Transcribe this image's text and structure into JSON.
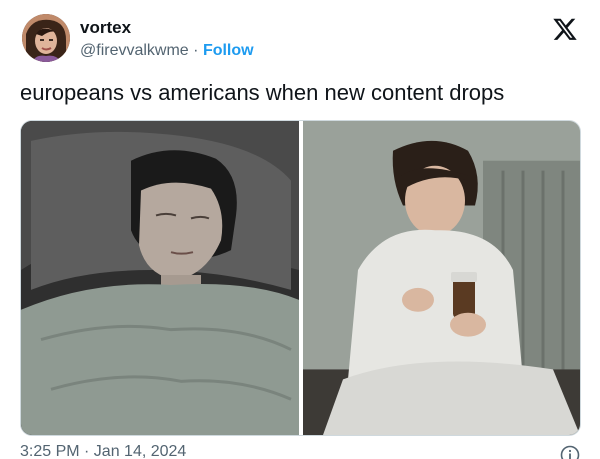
{
  "author": {
    "display_name": "vortex",
    "handle": "@firevvalkwme",
    "separator": "·",
    "follow_label": "Follow",
    "avatar_icon": "avatar-photo"
  },
  "brand": {
    "logo_icon": "x-logo-icon"
  },
  "tweet": {
    "text": "europeans vs americans when new content drops"
  },
  "media": {
    "images": [
      {
        "name": "sleeping-in-bed-photo"
      },
      {
        "name": "sitting-with-pill-bottle-photo"
      }
    ]
  },
  "footer": {
    "timestamp": "3:25 PM · Jan 14, 2024",
    "info_icon": "info-icon"
  },
  "colors": {
    "accent": "#1d9bf0",
    "text": "#0f1419",
    "secondary": "#536471"
  }
}
